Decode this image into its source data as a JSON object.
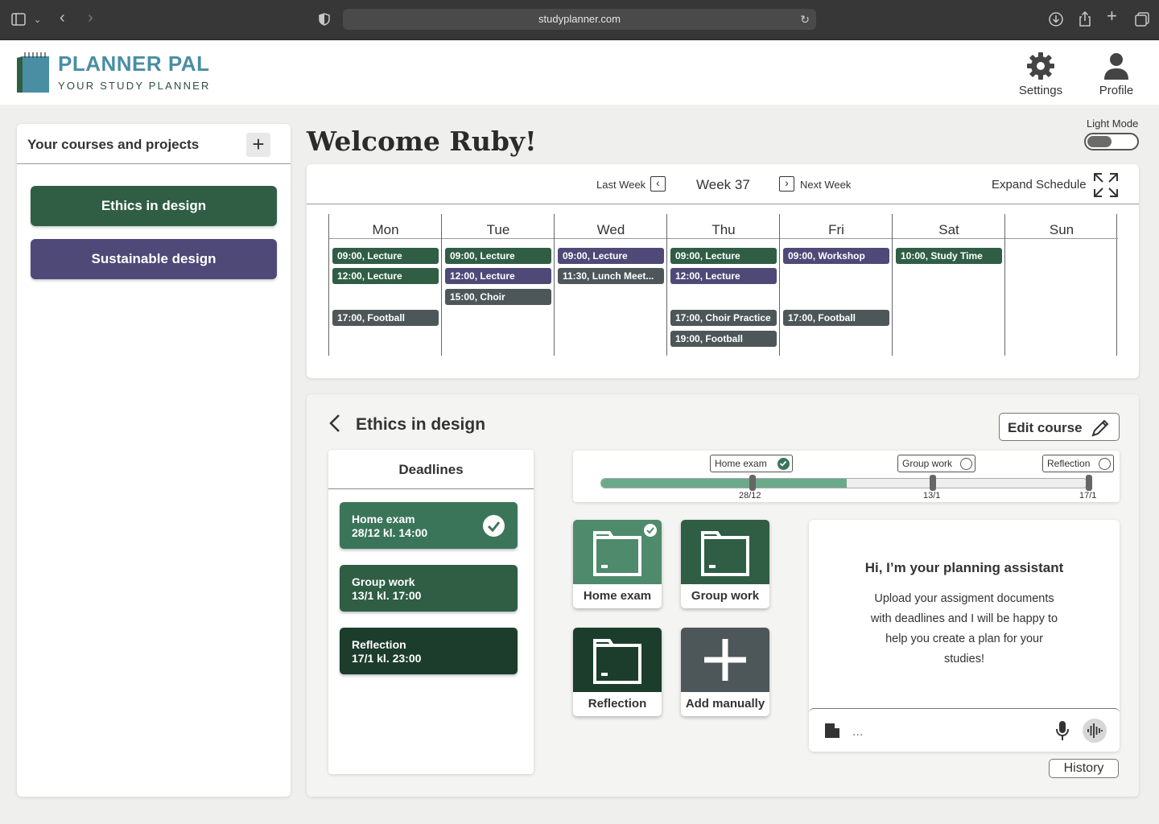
{
  "browser": {
    "url": "studyplanner.com"
  },
  "header": {
    "brand_title": "PLANNER PAL",
    "brand_subtitle": "YOUR STUDY PLANNER",
    "settings_label": "Settings",
    "profile_label": "Profile"
  },
  "sidebar": {
    "title": "Your courses and projects",
    "add_symbol": "+",
    "courses": [
      {
        "label": "Ethics in design",
        "color": "#2f5e45"
      },
      {
        "label": "Sustainable design",
        "color": "#4f4978"
      }
    ]
  },
  "welcome": {
    "title": "Welcome Ruby!",
    "mode_label": "Light Mode"
  },
  "schedule": {
    "last_week_label": "Last Week",
    "week_label": "Week 37",
    "next_week_label": "Next Week",
    "expand_label": "Expand Schedule",
    "days": [
      {
        "name": "Mon",
        "events": [
          {
            "text": "09:00, Lecture",
            "kind": "green"
          },
          {
            "text": "12:00, Lecture",
            "kind": "green"
          },
          {
            "text": "17:00, Football",
            "kind": "gray"
          }
        ]
      },
      {
        "name": "Tue",
        "events": [
          {
            "text": "09:00, Lecture",
            "kind": "green"
          },
          {
            "text": "12:00, Lecture",
            "kind": "purple"
          },
          {
            "text": "15:00, Choir",
            "kind": "gray"
          }
        ]
      },
      {
        "name": "Wed",
        "events": [
          {
            "text": "09:00, Lecture",
            "kind": "purple"
          },
          {
            "text": "11:30, Lunch Meet...",
            "kind": "gray"
          }
        ]
      },
      {
        "name": "Thu",
        "events": [
          {
            "text": "09:00, Lecture",
            "kind": "green"
          },
          {
            "text": "12:00, Lecture",
            "kind": "purple"
          },
          {
            "text": "17:00, Choir Practice",
            "kind": "gray"
          },
          {
            "text": "19:00, Football",
            "kind": "gray"
          }
        ]
      },
      {
        "name": "Fri",
        "events": [
          {
            "text": "09:00, Workshop",
            "kind": "purple"
          },
          {
            "text": "17:00, Football",
            "kind": "gray"
          }
        ]
      },
      {
        "name": "Sat",
        "events": [
          {
            "text": "10:00, Study Time",
            "kind": "green"
          }
        ]
      },
      {
        "name": "Sun",
        "events": []
      }
    ]
  },
  "course": {
    "title": "Ethics in design",
    "edit_label": "Edit course",
    "deadlines_title": "Deadlines",
    "deadlines": [
      {
        "name": "Home exam",
        "when": "28/12 kl. 14:00",
        "done": true,
        "color": "#3b7559"
      },
      {
        "name": "Group work",
        "when": "13/1 kl. 17:00",
        "done": false,
        "color": "#2f5e45"
      },
      {
        "name": "Reflection",
        "when": "17/1 kl. 23:00",
        "done": false,
        "color": "#1c3d2c"
      }
    ],
    "timeline": {
      "progress_fraction": 0.505,
      "milestones": [
        {
          "tag": "Home exam",
          "date": "28/12",
          "done": true
        },
        {
          "tag": "Group work",
          "date": "13/1",
          "done": false
        },
        {
          "tag": "Reflection",
          "date": "17/1",
          "done": false
        }
      ]
    },
    "tiles": [
      {
        "label": "Home exam",
        "color": "#4f8a6c",
        "done": true
      },
      {
        "label": "Group work",
        "color": "#2f5e45",
        "done": false
      },
      {
        "label": "Reflection",
        "color": "#1c3d2c",
        "done": false
      },
      {
        "label": "Add manually",
        "color": "#4d5659",
        "done": false
      }
    ],
    "assistant": {
      "title": "Hi, I’m your planning assistant",
      "body": "Upload your assigment documents with deadlines and I will be happy to help you create a plan for your studies!",
      "input_placeholder": "...",
      "history_label": "History"
    }
  }
}
